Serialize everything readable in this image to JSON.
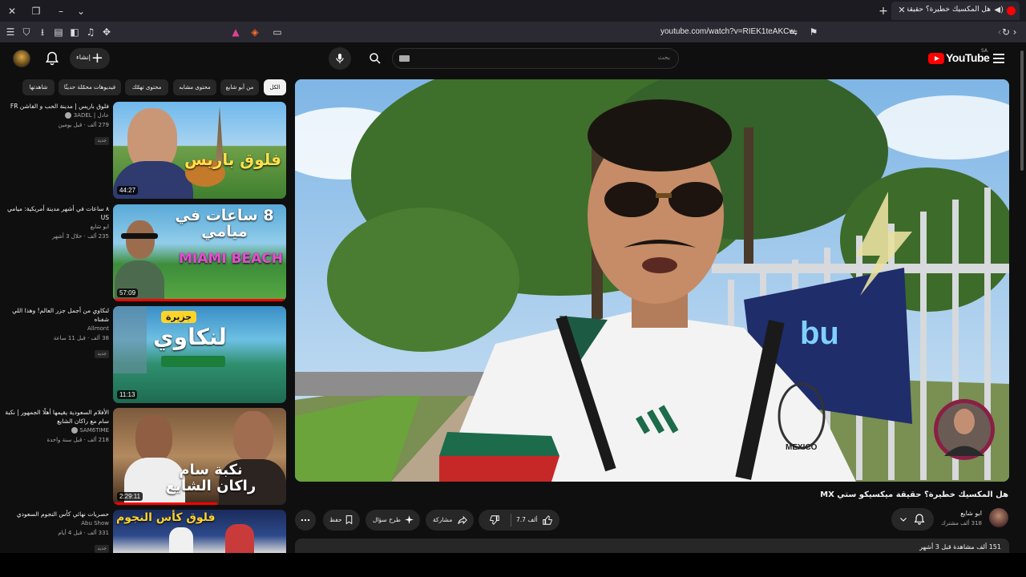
{
  "browser": {
    "tab_title": "هل المكسيك خطيرة؟ حقيقة مي",
    "url": "youtube.com/watch?v=RIEK1teAKCw"
  },
  "masthead": {
    "logo_text": "YouTube",
    "region": "SA",
    "search_placeholder": "بحث",
    "create_label": "إنشاء"
  },
  "chips": [
    "الكل",
    "من أبو شايع",
    "محتوى مشابه",
    "محتوى تهمّك",
    "فيديوهات محمّلة حديثًا",
    "شاهدتها"
  ],
  "recommendations": [
    {
      "title": "فلوق باريس | مدينة الحب و الفاشن FR",
      "channel": "3ADEL | عادل",
      "verified": true,
      "views": "279 ألف",
      "age": "قبل يومين",
      "badge": "جديد",
      "duration": "44:27",
      "thumb_text": "فلوق باريس",
      "progress": 0
    },
    {
      "title": "٨ ساعات في أشهر مدينة أمريكية: ميامي US",
      "channel": "ابو شايع",
      "verified": false,
      "views": "235 ألف",
      "age": "خلال 3 أشهر",
      "badge": "",
      "duration": "57:09",
      "thumb_text": "8 ساعات في ميامي",
      "progress": 1
    },
    {
      "title": "لنكاوي من أجمل جزر العالم! وهذا اللي شفناه",
      "channel": "Allmont",
      "verified": false,
      "views": "38 ألف",
      "age": "قبل 11 ساعة",
      "badge": "جديد",
      "duration": "11:13",
      "thumb_text": "لنكاوي",
      "progress": 0
    },
    {
      "title": "الأفلام السعودية يقيمها أهلًا الجمهور | نكبة سام مع راكان الشايع",
      "channel": "SAM6TIME",
      "verified": true,
      "views": "218 ألف",
      "age": "قبل سنة واحدة",
      "badge": "",
      "duration": "2:29:11",
      "thumb_text": "نكبة سام راكان الشايع",
      "progress": 0.6
    },
    {
      "title": "حصريات نهائي كأس النجوم السعودي",
      "channel": "Abu Show",
      "verified": false,
      "views": "331 ألف",
      "age": "قبل 4 أيام",
      "badge": "جديد",
      "duration": "",
      "thumb_text": "فلوق كأس النجوم",
      "progress": 0
    }
  ],
  "video": {
    "title": "هل المكسيك خطيرة؟ حقيقة ميكسيكو ستي MX",
    "channel": "ابو شايع",
    "subscribers": "318 ألف مشترك",
    "likes": "7.7 ألف",
    "share_label": "مشاركة",
    "ask_label": "طرح سؤال",
    "save_label": "حفظ",
    "description": "151 ألف مشاهدة  قبل 3 أشهر"
  }
}
